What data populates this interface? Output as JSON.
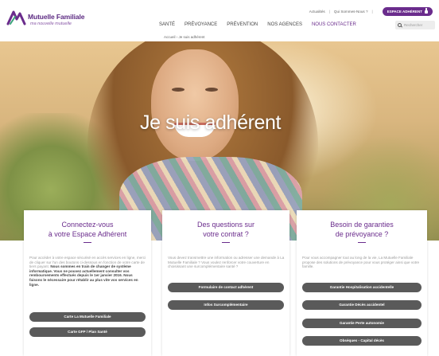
{
  "header": {
    "logo": {
      "name": "Mutuelle Familiale",
      "tagline": "ma nouvelle mutuelle"
    },
    "toplinks": [
      "Actualités",
      "Qui Sommes-Nous ?"
    ],
    "espace_button": "ESPACE ADHÉRENT",
    "nav": [
      "SANTÉ",
      "PRÉVOYANCE",
      "PRÉVENTION",
      "NOS AGENCES",
      "NOUS CONTACTER"
    ],
    "search_placeholder": "Rechercher",
    "breadcrumb": "Accueil › Je suis adhérent"
  },
  "hero": {
    "title": "Je suis adhérent"
  },
  "cards": [
    {
      "title_line1": "Connectez-vous",
      "title_line2": "à votre Espace Adhérent",
      "text": "Pour accéder à votre espace sécurisé en accès services en ligne, merci de cliquer sur l'un des boutons ci-dessous en fonction de votre carte de tiers payant.",
      "text_bold": "Nous sommes en train de changer de système informatique. Vous ne pouvez actuellement consulter vos remboursements effectués depuis le 1er janvier 2016. Nous faisons le nécessaire pour rétablir au plus vite vos services en ligne.",
      "buttons": [
        "Carte La Mutuelle Familiale",
        "Carte GFP / Plan Santé"
      ]
    },
    {
      "title_line1": "Des questions sur",
      "title_line2": "votre contrat ?",
      "text": "Vous devez transmettre une information ou adresser une demande à La Mutuelle Familiale ? Vous voulez renforcer votre couverture en choisissant une surcomplémentaire santé ?",
      "buttons": [
        "Formulaire de contact adhérent",
        "Infos Surcomplémentaire"
      ]
    },
    {
      "title_line1": "Besoin de garanties",
      "title_line2": "de prévoyance ?",
      "text": "Pour vous accompagner tout au long de la vie, La Mutuelle Familiale propose des solutions de prévoyance pour vous protéger ainsi que votre famille.",
      "buttons": [
        "Garantie Hospitalisation accidentelle",
        "Garantie Décès accidentel",
        "Garantie Perte autonomie",
        "Obsèques - Capital décès"
      ]
    }
  ],
  "colors": {
    "brand": "#6a2c8c",
    "button": "#5a5a5a"
  }
}
